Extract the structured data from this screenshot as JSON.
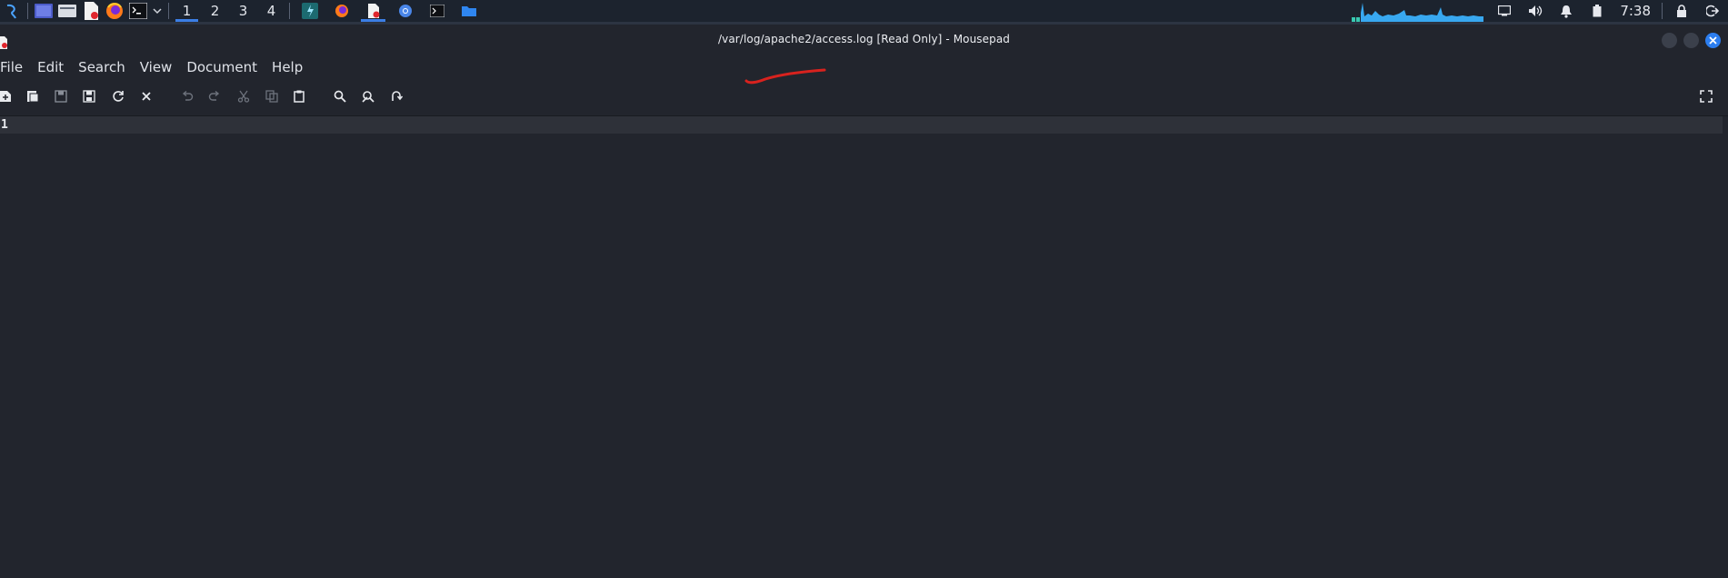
{
  "panel": {
    "workspaces": [
      "1",
      "2",
      "3",
      "4"
    ],
    "active_workspace": "1",
    "launchers": [
      "kali-menu-icon",
      "desktop-icon",
      "file-manager-icon",
      "text-editor-icon",
      "firefox-icon",
      "terminal-icon"
    ],
    "tasks": [
      "app-icon",
      "firefox-icon",
      "mousepad-icon",
      "chromium-icon",
      "terminal-icon",
      "folder-icon"
    ],
    "tray_icons": [
      "display-icon",
      "volume-icon",
      "notification-bell-icon",
      "battery-icon"
    ],
    "clock": "7:38",
    "colors": {
      "panel_bg": "#1c232e",
      "accent": "#3b7ee5",
      "graph": "#38a8f0"
    }
  },
  "window": {
    "title": "/var/log/apache2/access.log [Read Only] - Mousepad",
    "buttons": [
      "minimize",
      "maximize",
      "close"
    ],
    "colors": {
      "bg": "#22252d",
      "close": "#2c7ef0"
    }
  },
  "menubar": {
    "items": [
      "File",
      "Edit",
      "Search",
      "View",
      "Document",
      "Help"
    ]
  },
  "toolbar": {
    "icons": [
      "new-document-icon",
      "new-window-icon",
      "save-icon",
      "save-as-icon",
      "reload-icon",
      "close-document-icon",
      "undo-icon",
      "redo-icon",
      "cut-icon",
      "copy-icon",
      "paste-icon",
      "find-icon",
      "find-replace-icon",
      "go-to-line-icon",
      "fullscreen-icon"
    ]
  },
  "editor": {
    "line_number": "1",
    "content": ""
  }
}
